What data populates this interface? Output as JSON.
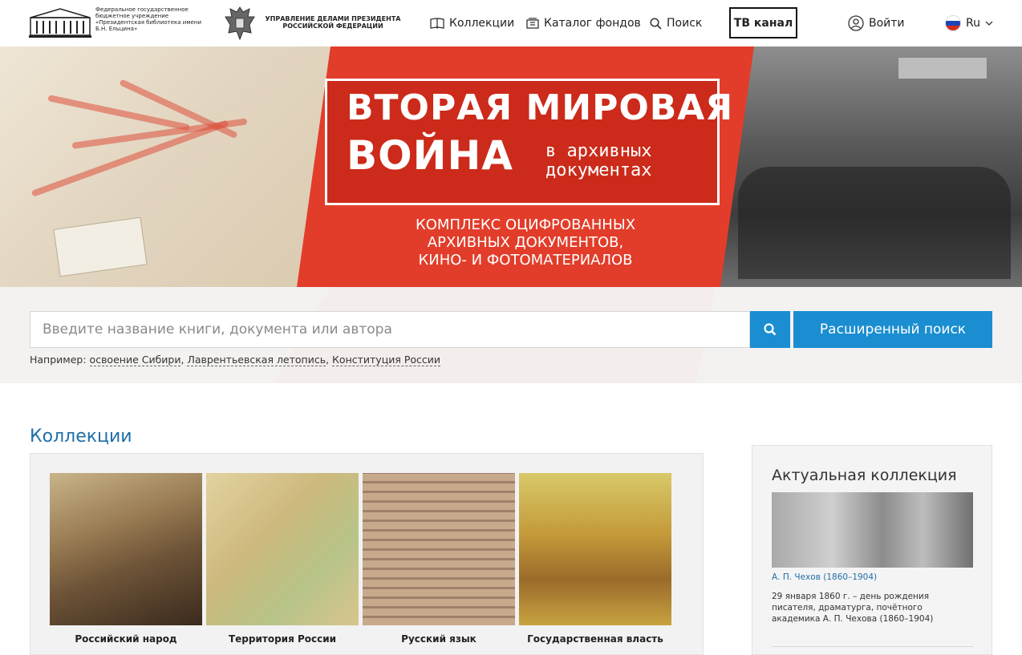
{
  "header": {
    "library_text": "Федеральное государственное бюджетное учреждение «Президентская библиотека имени Б.Н. Ельцина»",
    "upr_text": "УПРАВЛЕНИЕ ДЕЛАМИ ПРЕЗИДЕНТА РОССИЙСКОЙ ФЕДЕРАЦИИ",
    "nav": {
      "collections": "Коллекции",
      "catalog": "Каталог фондов",
      "search": "Поиск",
      "tv": "ТВ канал",
      "login": "Войти",
      "lang": "Ru"
    }
  },
  "hero": {
    "title_line1": "ВТОРАЯ МИРОВАЯ",
    "title_line2": "ВОЙНА",
    "title_small1": "в архивных",
    "title_small2": "документах",
    "subtitle_line1": "КОМПЛЕКС ОЦИФРОВАННЫХ",
    "subtitle_line2": "АРХИВНЫХ ДОКУМЕНТОВ,",
    "subtitle_line3": "КИНО- И ФОТОМАТЕРИАЛОВ"
  },
  "search": {
    "placeholder": "Введите название книги, документа или автора",
    "advanced_label": "Расширенный поиск",
    "examples_prefix": "Например:",
    "examples": [
      "освоение Сибири",
      "Лаврентьевская летопись",
      "Конституция России"
    ]
  },
  "collections": {
    "title": "Коллекции",
    "items": [
      {
        "label": "Российский народ"
      },
      {
        "label": "Территория России"
      },
      {
        "label": "Русский язык"
      },
      {
        "label": "Государственная власть"
      }
    ]
  },
  "actual": {
    "title": "Актуальная коллекция",
    "link": "А. П. Чехов (1860–1904)",
    "description": "29 января 1860 г. – день рождения писателя, драматурга, почётного академика А. П. Чехова (1860–1904)"
  },
  "colors": {
    "accent_blue": "#1b8ed1",
    "hero_red": "#e23d2a",
    "title_blue": "#1f6fa8"
  }
}
